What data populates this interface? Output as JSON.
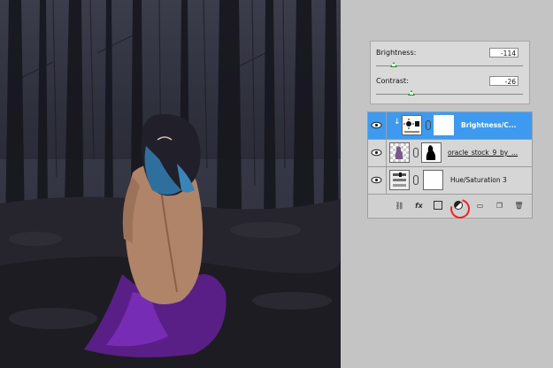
{
  "adjustments": {
    "brightness_label": "Brightness:",
    "brightness_value": "-114",
    "contrast_label": "Contrast:",
    "contrast_value": "-26"
  },
  "layers": [
    {
      "name": "Brightness/C...",
      "selected": true
    },
    {
      "name": "oracle_stock_9_by_...",
      "selected": false
    },
    {
      "name": "Hue/Saturation 3",
      "selected": false
    }
  ],
  "toolbar_icons": [
    "link-icon",
    "fx-icon",
    "mask-icon",
    "adjustment-icon",
    "folder-icon",
    "new-layer-icon",
    "trash-icon"
  ],
  "colors": {
    "selected_layer": "#3d9af0",
    "highlight_circle": "#e22222"
  }
}
